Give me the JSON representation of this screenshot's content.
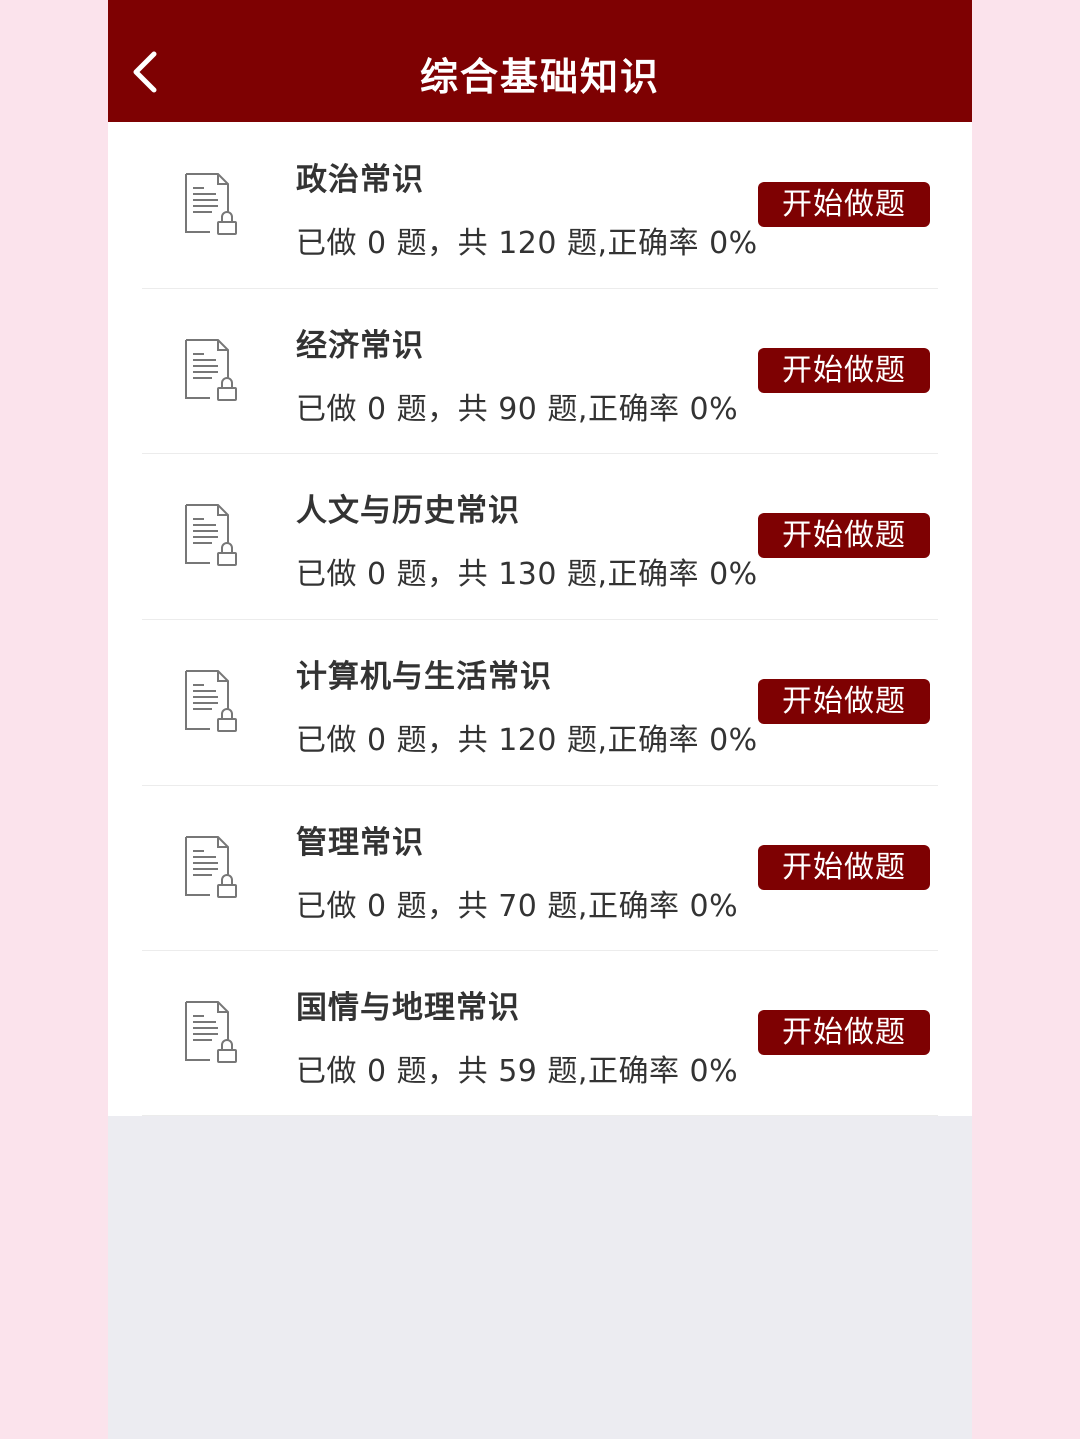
{
  "header": {
    "title": "综合基础知识"
  },
  "items": [
    {
      "title": "政治常识",
      "stats": "已做 0 题，共 120 题,正确率 0%",
      "button": "开始做题"
    },
    {
      "title": "经济常识",
      "stats": "已做 0 题，共 90 题,正确率 0%",
      "button": "开始做题"
    },
    {
      "title": "人文与历史常识",
      "stats": "已做 0 题，共 130 题,正确率 0%",
      "button": "开始做题"
    },
    {
      "title": "计算机与生活常识",
      "stats": "已做 0 题，共 120 题,正确率 0%",
      "button": "开始做题"
    },
    {
      "title": "管理常识",
      "stats": "已做 0 题，共 70 题,正确率 0%",
      "button": "开始做题"
    },
    {
      "title": "国情与地理常识",
      "stats": "已做 0 题，共 59 题,正确率 0%",
      "button": "开始做题"
    }
  ],
  "icons": {
    "back": "chevron-left-icon",
    "item": "locked-document-icon"
  },
  "colors": {
    "brand": "#7e0102",
    "background": "#ececf1",
    "outer": "#fbe3ec"
  }
}
